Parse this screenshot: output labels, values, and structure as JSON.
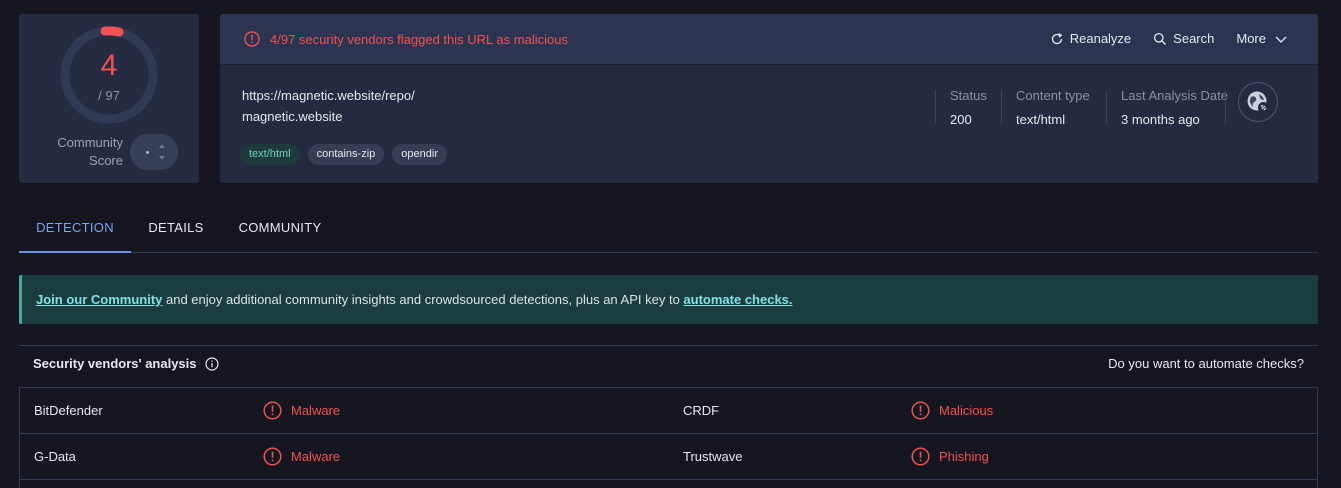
{
  "score": {
    "detections": "4",
    "total": "/ 97",
    "community_label": "Community Score"
  },
  "alert": {
    "text": "4/97 security vendors flagged this URL as malicious"
  },
  "actions": {
    "reanalyze": "Reanalyze",
    "search": "Search",
    "more": "More"
  },
  "url": {
    "full": "https://magnetic.website/repo/",
    "domain": "magnetic.website"
  },
  "tags": [
    "text/html",
    "contains-zip",
    "opendir"
  ],
  "meta": {
    "status_label": "Status",
    "status_value": "200",
    "content_type_label": "Content type",
    "content_type_value": "text/html",
    "last_analysis_label": "Last Analysis Date",
    "last_analysis_value": "3 months ago"
  },
  "tabs": [
    {
      "label": "DETECTION"
    },
    {
      "label": "DETAILS"
    },
    {
      "label": "COMMUNITY"
    }
  ],
  "banner": {
    "link1": "Join our Community",
    "middle": " and enjoy additional community insights and crowdsourced detections, plus an API key to ",
    "link2": "automate checks."
  },
  "vendors": {
    "title": "Security vendors' analysis",
    "automate": "Do you want to automate checks?",
    "rows": [
      {
        "left_name": "BitDefender",
        "left_result": "Malware",
        "right_name": "CRDF",
        "right_result": "Malicious"
      },
      {
        "left_name": "G-Data",
        "left_result": "Malware",
        "right_name": "Trustwave",
        "right_result": "Phishing"
      }
    ]
  },
  "colors": {
    "danger": "#f05151",
    "accent": "#7fa2f4",
    "banner_link": "#7fe0e5"
  }
}
